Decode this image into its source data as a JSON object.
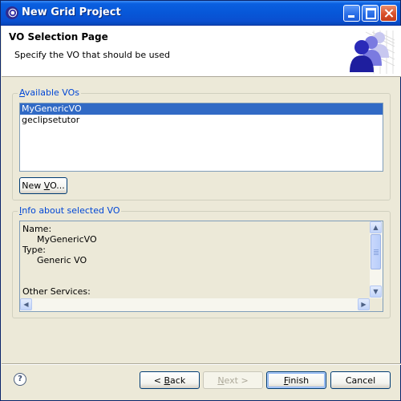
{
  "window": {
    "title": "New Grid Project",
    "icons": [
      "eclipse-app-icon",
      "minimize-icon",
      "maximize-icon",
      "close-icon"
    ]
  },
  "header": {
    "title": "VO Selection Page",
    "description": "Specify the VO that should be used"
  },
  "available_vos": {
    "label": "Available VOs",
    "items": [
      "MyGenericVO",
      "geclipsetutor"
    ],
    "selected": "MyGenericVO",
    "new_button": "New VO..."
  },
  "info": {
    "label": "Info about selected VO",
    "name_label": "Name:",
    "name_value": "MyGenericVO",
    "type_label": "Type:",
    "type_value": "Generic VO",
    "other_label": "Other Services:"
  },
  "footer": {
    "back": "< Back",
    "next": "Next >",
    "finish": "Finish",
    "cancel": "Cancel"
  },
  "colors": {
    "title_bar": "#0757d8",
    "selection": "#316ac5",
    "group_label": "#0046d5"
  }
}
